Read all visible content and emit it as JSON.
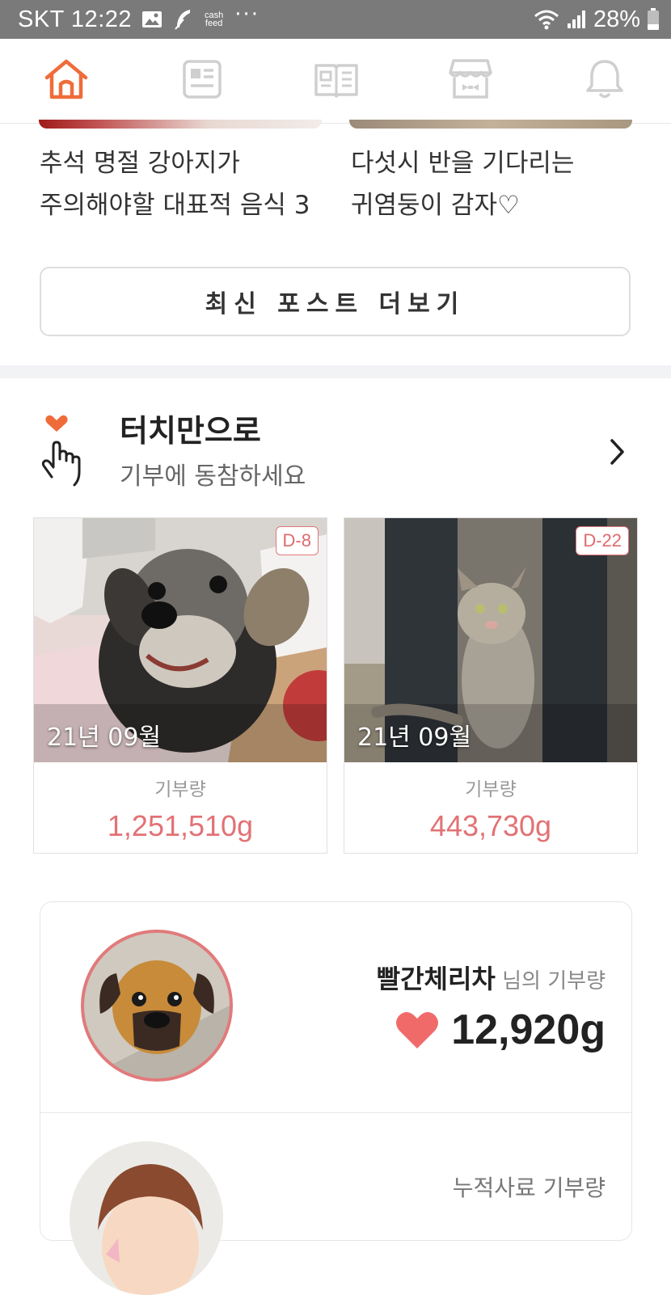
{
  "status_bar": {
    "carrier_time": "SKT 12:22",
    "cash_feed": "cash\nfeed",
    "dots": "···",
    "battery": "28%"
  },
  "nav": {
    "items": [
      "home-icon",
      "news-icon",
      "book-icon",
      "shop-icon",
      "bell-icon"
    ],
    "active_color": "#ef6c3a",
    "inactive_color": "#cfcfcf"
  },
  "articles": [
    {
      "title_line1": "추석 명절 강아지가",
      "title_line2": "주의해야할 대표적 음식 3"
    },
    {
      "title_line1": "다섯시 반을 기다리는",
      "title_line2": "귀염둥이 감자♡"
    }
  ],
  "more_posts_button": "최신 포스트 더보기",
  "donation_section": {
    "title": "터치만으로",
    "subtitle": "기부에 동참하세요",
    "cards": [
      {
        "dday": "D-8",
        "date": "21년 09월",
        "label": "기부량",
        "amount": "1,251,510g"
      },
      {
        "dday": "D-22",
        "date": "21년 09월",
        "label": "기부량",
        "amount": "443,730g"
      }
    ]
  },
  "profile": {
    "username": "빨간체리차",
    "suffix": " 님의 기부량",
    "donation": "12,920g",
    "cumulative_label": "누적사료 기부량"
  },
  "colors": {
    "accent": "#ef6c3a",
    "amount": "#e27275",
    "heart": "#f06a6a"
  }
}
